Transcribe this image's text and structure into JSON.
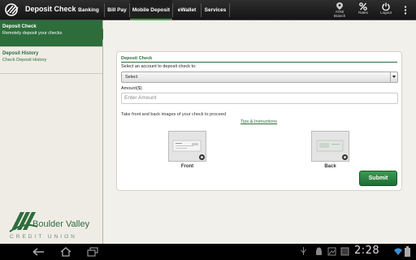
{
  "app": {
    "title": "Deposit Check",
    "icon": "deposit-check-icon"
  },
  "nav": {
    "tabs": [
      {
        "label": "Banking",
        "active": false
      },
      {
        "label": "Bill Pay",
        "active": false
      },
      {
        "label": "Mobile Deposit",
        "active": true
      },
      {
        "label": "eWallet",
        "active": false
      },
      {
        "label": "Services",
        "active": false
      }
    ],
    "actions": [
      {
        "label": "ATM/\nBranch",
        "icon": "location-pin-icon"
      },
      {
        "label": "Rates",
        "icon": "percent-icon"
      },
      {
        "label": "Logout",
        "icon": "power-icon"
      }
    ],
    "overflow_icon": "overflow-menu-icon"
  },
  "sidebar": {
    "items": [
      {
        "title": "Deposit Check",
        "subtitle": "Remotely deposit your checks",
        "active": true
      },
      {
        "title": "Deposit History",
        "subtitle": "Check Deposit History",
        "active": false
      }
    ],
    "logo": {
      "name": "Boulder Valley",
      "tagline": "CREDIT UNION"
    }
  },
  "form": {
    "title": "Deposit Check",
    "account_label": "Select an account to deposit check to:",
    "account_value": "Select",
    "amount_label": "Amount($)",
    "amount_placeholder": "Enter Amount",
    "instructions": "Take front and back images of your check to proceed",
    "tips_link": "Tips & Instructions",
    "front_label": "Front",
    "back_label": "Back",
    "submit_label": "Submit"
  },
  "system_bar": {
    "time": "2:28",
    "icons": [
      "back-icon",
      "home-icon",
      "recent-apps-icon",
      "usb-icon",
      "android-debug-icon",
      "gallery-icon",
      "wifi-icon",
      "battery-icon"
    ]
  },
  "colors": {
    "brand_green": "#2d6d3b",
    "submit_green": "#2a8a44",
    "topbar": "#1c1c1c"
  }
}
